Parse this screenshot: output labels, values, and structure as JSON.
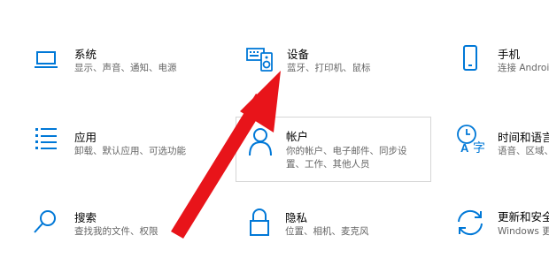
{
  "settings_tiles": [
    {
      "title": "系统",
      "desc": "显示、声音、通知、电源",
      "icon": "laptop-icon"
    },
    {
      "title": "设备",
      "desc": "蓝牙、打印机、鼠标",
      "icon": "keyboard-speaker-icon"
    },
    {
      "title": "手机",
      "desc": "连接 Androi",
      "icon": "phone-icon"
    },
    {
      "title": "应用",
      "desc": "卸载、默认应用、可选功能",
      "icon": "apps-list-icon"
    },
    {
      "title": "帐户",
      "desc_lines": [
        "你的帐户、电子邮件、同步设",
        "置、工作、其他人员"
      ],
      "icon": "person-icon"
    },
    {
      "title": "时间和语言",
      "desc": "语音、区域、",
      "icon": "time-language-icon"
    },
    {
      "title": "搜索",
      "desc": "查找我的文件、权限",
      "icon": "search-icon"
    },
    {
      "title": "隐私",
      "desc": "位置、相机、麦克风",
      "icon": "lock-icon"
    },
    {
      "title": "更新和安全",
      "desc": "Windows 更新",
      "icon": "sync-icon"
    }
  ],
  "colors": {
    "accent": "#0078d7",
    "arrow": "#e8141a",
    "text": "#000000",
    "secondary_text": "#666666",
    "hover_border": "#d6d6d6"
  }
}
